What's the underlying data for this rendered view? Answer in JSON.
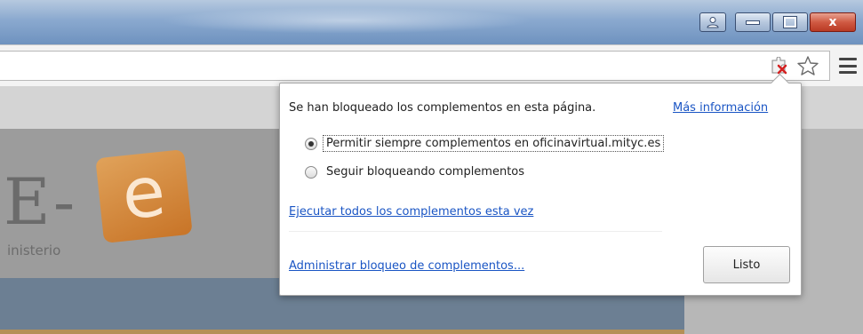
{
  "window": {
    "controls": {
      "user_icon": "user-icon",
      "minimize_icon": "minimize-icon",
      "maximize_icon": "maximize-icon",
      "close_glyph": "x"
    }
  },
  "toolbar": {
    "plugin_blocked_icon": "plugin-blocked-icon",
    "bookmark_icon": "star-icon",
    "menu_icon": "hamburger-menu-icon"
  },
  "page": {
    "logo_text": "E-",
    "logo_badge": "e",
    "ministry_text": "inisterio"
  },
  "bubble": {
    "title": "Se han bloqueado los complementos en esta página.",
    "more_info": "Más información",
    "options": [
      {
        "label": "Permitir siempre complementos en oficinavirtual.mityc.es",
        "selected": true
      },
      {
        "label": "Seguir bloqueando complementos",
        "selected": false
      }
    ],
    "run_all_link": "Ejecutar todos los complementos esta vez",
    "manage_link": "Administrar bloqueo de complementos...",
    "done_button": "Listo"
  },
  "colors": {
    "link": "#1a55c4",
    "close_button": "#c8432c",
    "title_bar": "#8aa9cf"
  }
}
